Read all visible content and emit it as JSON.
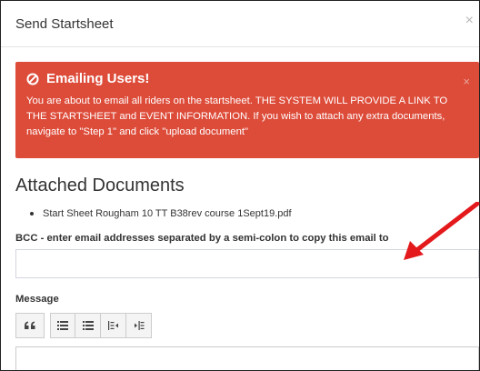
{
  "modal": {
    "title": "Send Startsheet",
    "close_glyph": "×"
  },
  "alert": {
    "title": "Emailing Users!",
    "close_glyph": "×",
    "icon": "ban-icon",
    "message": "You are about to email all riders on the startsheet. THE SYSTEM WILL PROVIDE A LINK TO THE STARTSHEET and EVENT INFORMATION. If you wish to attach any extra documents, navigate to \"Step 1\" and click \"upload document\"",
    "color": "#dd4b39"
  },
  "attachments": {
    "title": "Attached Documents",
    "files": [
      "Start Sheet Rougham 10 TT B38rev course 1Sept19.pdf"
    ]
  },
  "bcc": {
    "label": "BCC - enter email addresses separated by a semi-colon to copy this email to",
    "value": "",
    "placeholder": ""
  },
  "message": {
    "label": "Message",
    "toolbar": [
      "blockquote-icon",
      "unordered-list-icon",
      "ordered-list-icon",
      "outdent-icon",
      "indent-icon"
    ],
    "quote_glyph": "66"
  },
  "annotation": {
    "arrow_color": "#e3191b"
  }
}
